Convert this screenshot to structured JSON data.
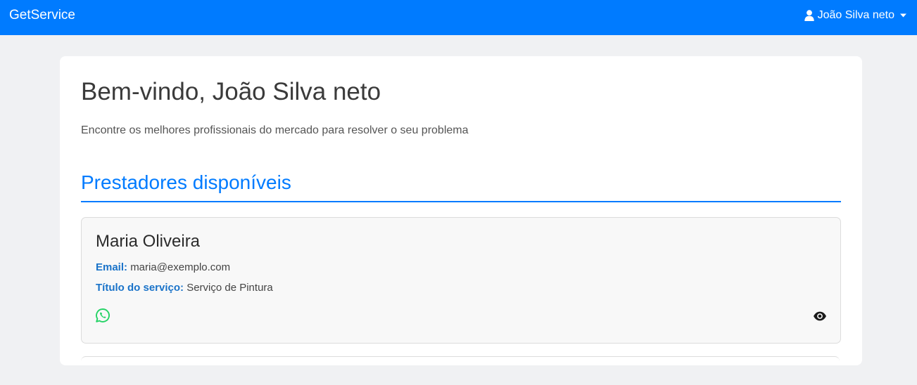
{
  "navbar": {
    "brand": "GetService",
    "user_name": "João Silva neto",
    "bg_color": "#007bff",
    "user_icon": "user-icon",
    "caret_icon": "caret-down-icon"
  },
  "main": {
    "welcome": "Bem-vindo, João Silva neto",
    "subtitle": "Encontre os melhores profissionais do mercado para resolver o seu problema",
    "section_title": "Prestadores disponíveis",
    "providers": [
      {
        "name": "Maria Oliveira",
        "email_label": "Email:",
        "email": "maria@exemplo.com",
        "service_label": "Título do serviço:",
        "service": "Serviço de Pintura",
        "whatsapp_icon": "whatsapp-icon",
        "view_icon": "eye-icon",
        "whatsapp_color": "#25d366"
      }
    ]
  }
}
